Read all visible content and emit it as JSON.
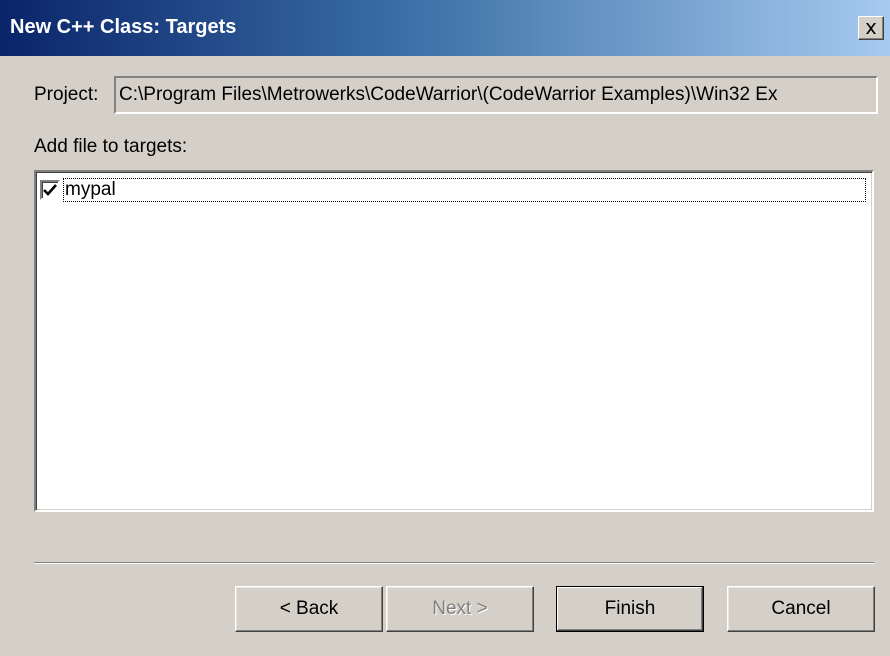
{
  "window": {
    "title": "New C++ Class: Targets",
    "close_label": "×"
  },
  "project": {
    "label": "Project:",
    "value": "C:\\Program Files\\Metrowerks\\CodeWarrior\\(CodeWarrior Examples)\\Win32 Ex"
  },
  "targets": {
    "label": "Add file to targets:",
    "items": [
      {
        "label": "mypal",
        "checked": true
      }
    ]
  },
  "buttons": {
    "back": "< Back",
    "next": "Next >",
    "finish": "Finish",
    "cancel": "Cancel"
  },
  "colors": {
    "titlebar_start": "#0a246a",
    "titlebar_end": "#a6caf0",
    "face": "#d4d0c8"
  }
}
